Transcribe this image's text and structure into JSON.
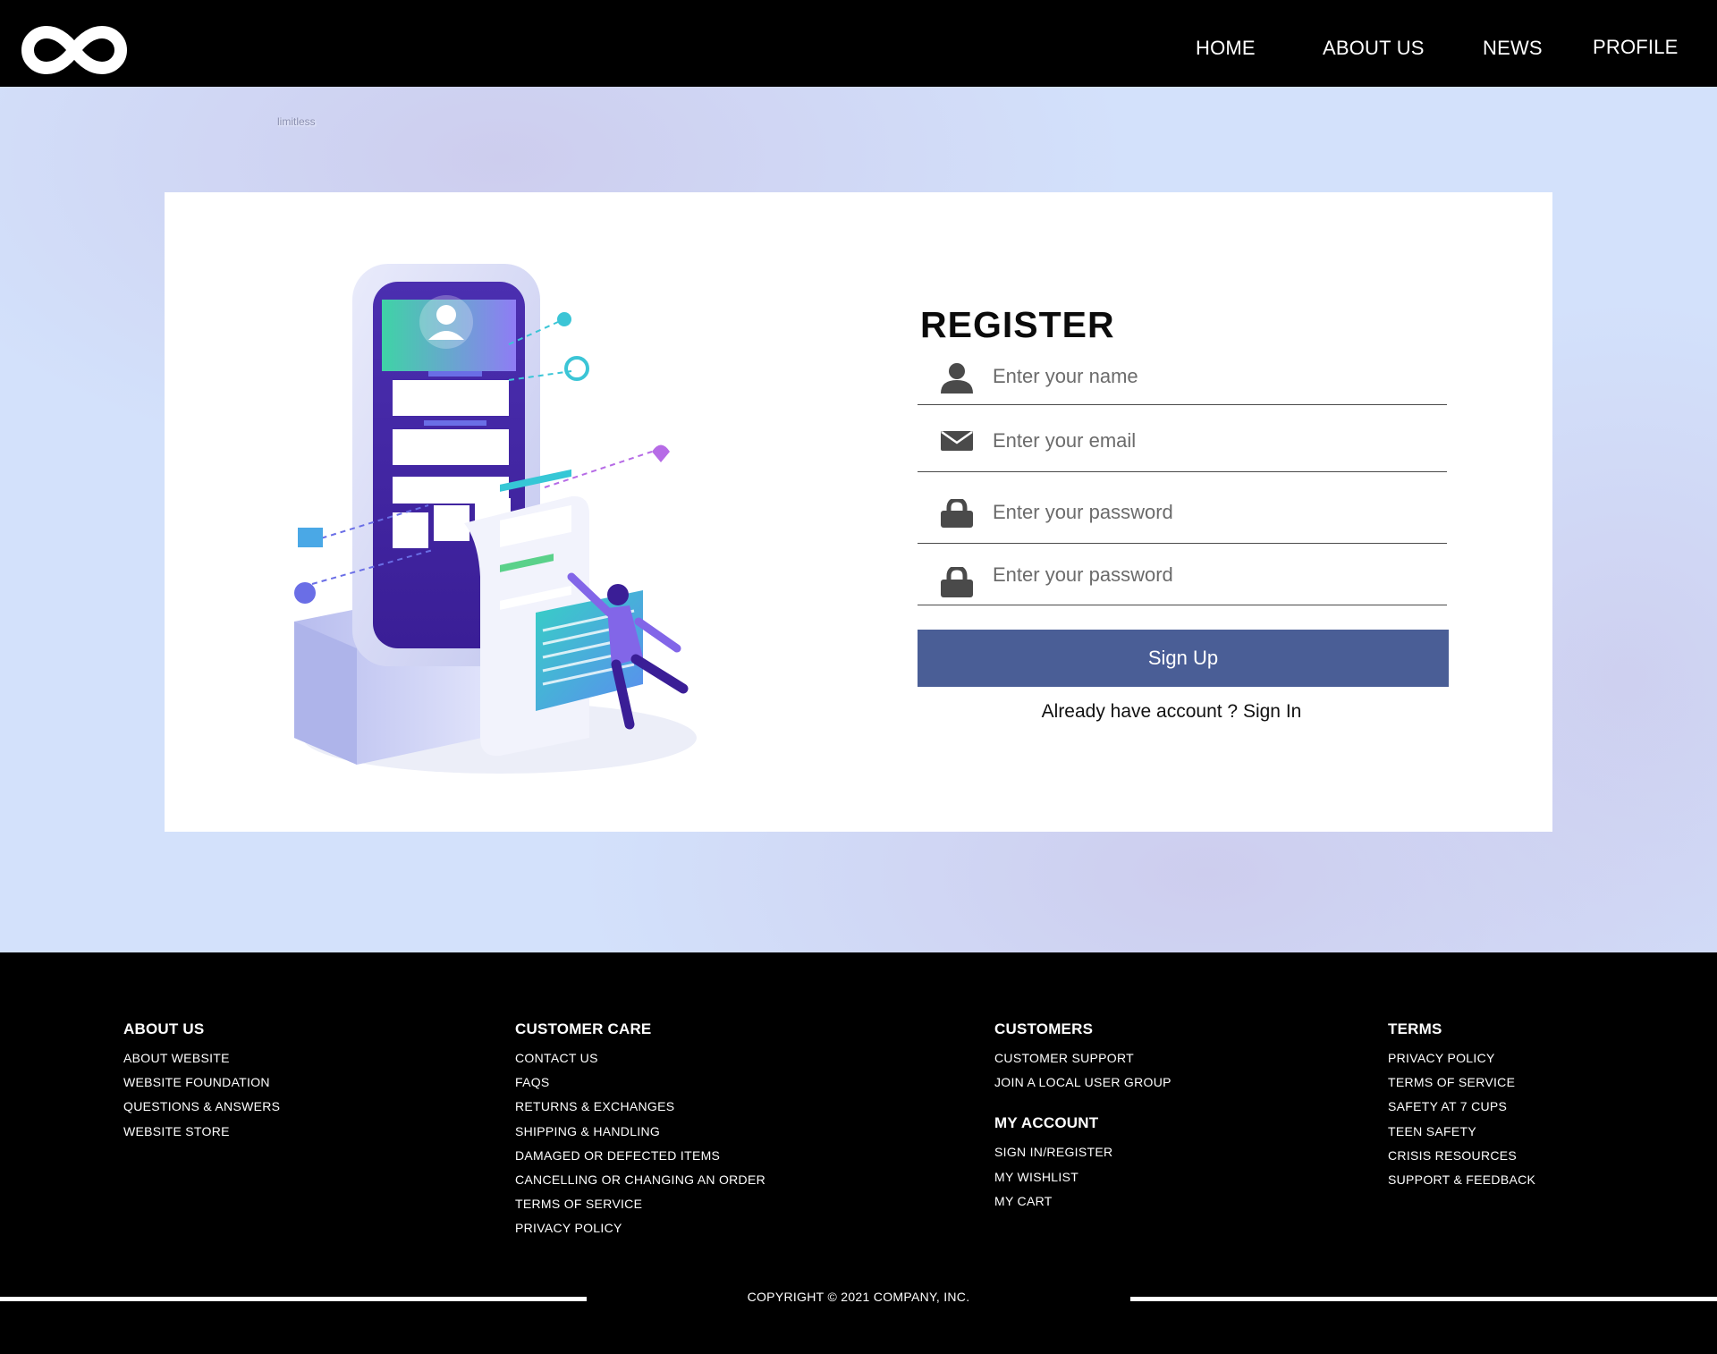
{
  "nav": {
    "home": "HOME",
    "about": "ABOUT US",
    "news": "NEWS",
    "profile": "PROFILE"
  },
  "brand_tag": "limitless",
  "form": {
    "title": "REGISTER",
    "name_placeholder": "Enter your name",
    "email_placeholder": "Enter your email",
    "password_placeholder": "Enter your password",
    "confirm_placeholder": "Enter your password",
    "signup_label": "Sign Up",
    "signin_prefix": "Already have account ? ",
    "signin_link": "Sign In"
  },
  "footer": {
    "about": {
      "title": "ABOUT US",
      "links": [
        "ABOUT WEBSITE",
        "WEBSITE FOUNDATION",
        "QUESTIONS & ANSWERS",
        "WEBSITE STORE"
      ]
    },
    "care": {
      "title": "CUSTOMER CARE",
      "links": [
        "CONTACT US",
        "FAQS",
        "RETURNS & EXCHANGES",
        "SHIPPING & HANDLING",
        "DAMAGED OR DEFECTED ITEMS",
        "CANCELLING OR CHANGING AN ORDER",
        "TERMS OF SERVICE",
        "PRIVACY POLICY"
      ]
    },
    "customers": {
      "title": "CUSTOMERS",
      "links": [
        "CUSTOMER SUPPORT",
        "JOIN A LOCAL USER GROUP"
      ]
    },
    "account": {
      "title": "MY ACCOUNT",
      "links": [
        "SIGN IN/REGISTER",
        "MY WISHLIST",
        "MY CART"
      ]
    },
    "terms": {
      "title": "TERMS",
      "links": [
        "PRIVACY POLICY",
        "TERMS OF SERVICE",
        "SAFETY AT 7 CUPS",
        "TEEN SAFETY",
        "CRISIS RESOURCES",
        "SUPPORT & FEEDBACK"
      ]
    },
    "copyright": "COPYRIGHT © 2021 COMPANY, INC."
  },
  "icons": {
    "logo": "infinity-logo-icon",
    "name": "user-icon",
    "email": "envelope-icon",
    "password": "lock-icon"
  },
  "colors": {
    "header_bg": "#000000",
    "page_bg": "#d3e1fb",
    "button": "#4a5e96",
    "footer_bg": "#000000"
  }
}
